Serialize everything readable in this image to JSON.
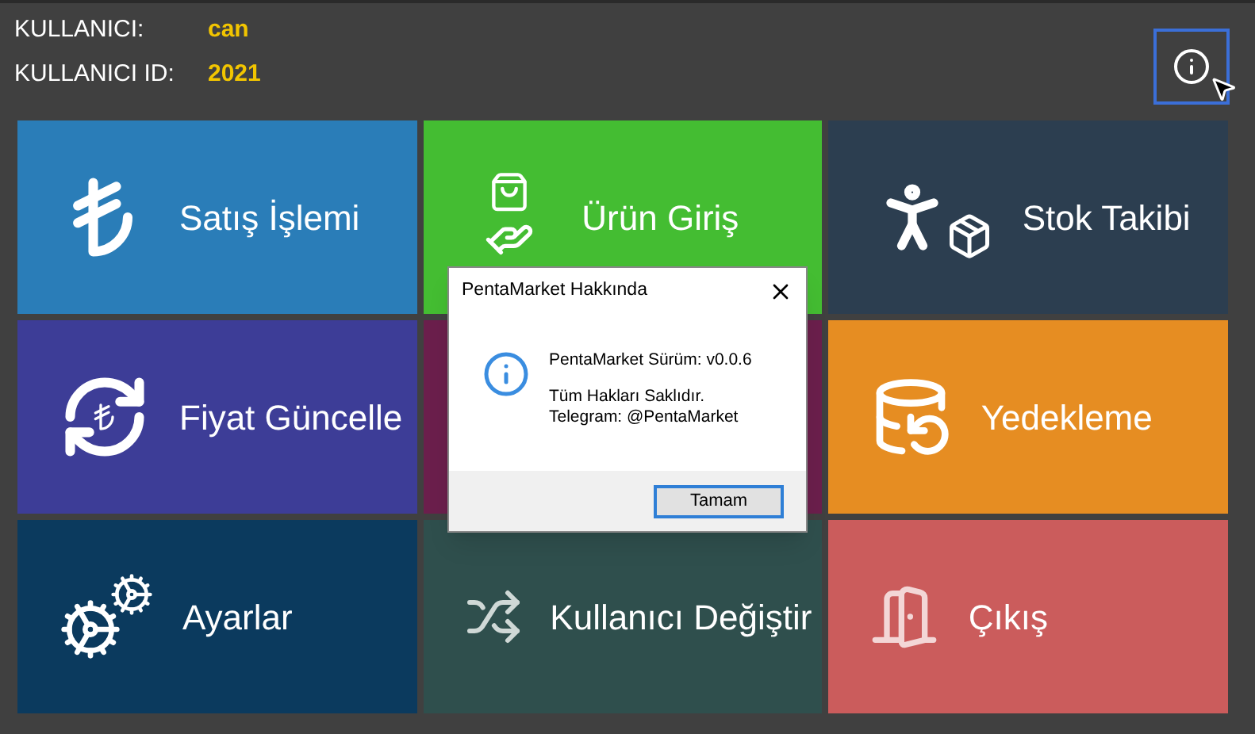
{
  "user": {
    "label": "KULLANICI:",
    "value": "can"
  },
  "user_id": {
    "label": "KULLANICI ID:",
    "value": "2021"
  },
  "info_button": {
    "focused": true
  },
  "tiles": [
    {
      "label": "Satış İşlemi",
      "color": "#2a7db8"
    },
    {
      "label": "Ürün Giriş",
      "color": "#44bd32"
    },
    {
      "label": "Stok Takibi",
      "color": "#2c3e50"
    },
    {
      "label": "Fiyat Güncelle",
      "color": "#3d3d97"
    },
    {
      "color": "#6b1f4c"
    },
    {
      "label": "Yedekleme",
      "color": "#e68d22"
    },
    {
      "label": "Ayarlar",
      "color": "#0b3a5e"
    },
    {
      "label": "Kullanıcı Değiştir",
      "color": "#2f4f4d"
    },
    {
      "label": "Çıkış",
      "color": "#cb5c5c"
    }
  ],
  "dialog": {
    "title": "PentaMarket Hakkında",
    "version": "PentaMarket Sürüm: v0.0.6",
    "rights": "Tüm Hakları Saklıdır.",
    "contact": "Telegram: @PentaMarket",
    "button": "Tamam"
  }
}
